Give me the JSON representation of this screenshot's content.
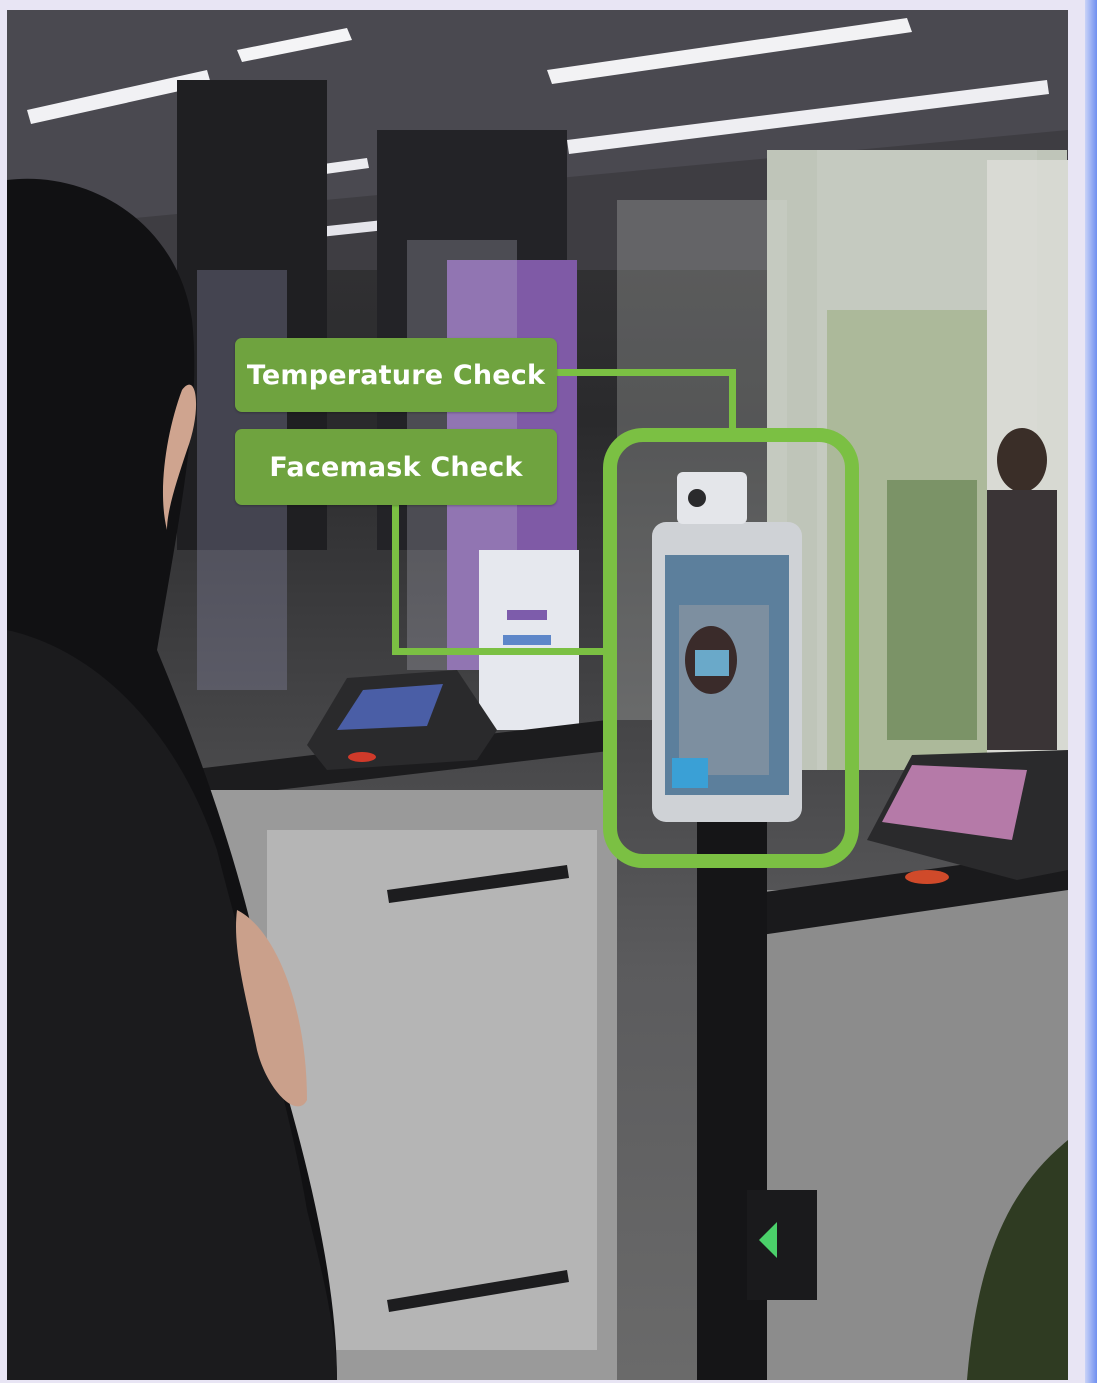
{
  "annotations": {
    "temperature_label": "Temperature Check",
    "facemask_label": "Facemask Check"
  },
  "colors": {
    "callout_fill": "#6fa33f",
    "highlight_stroke": "#7bc043",
    "frame_background": "#e8e5f4",
    "frame_accent": "#6f8ff0"
  },
  "scene": {
    "subject": "person-at-turnstile",
    "device": "thermal-face-recognition-terminal"
  }
}
